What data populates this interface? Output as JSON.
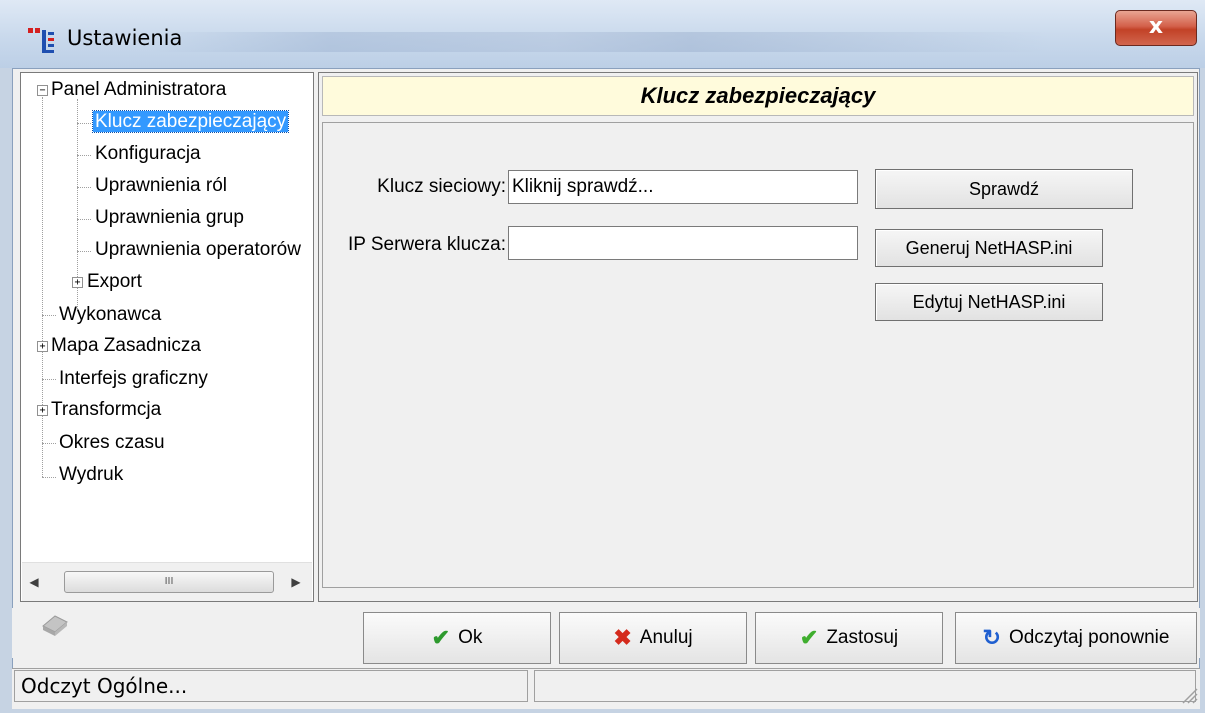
{
  "window": {
    "title": "Ustawienia",
    "close_label": "x"
  },
  "tree": {
    "items": [
      {
        "label": "Panel Administratora",
        "expander": "−"
      },
      {
        "label": "Klucz zabezpieczający",
        "selected": true
      },
      {
        "label": "Konfiguracja"
      },
      {
        "label": "Uprawnienia ról"
      },
      {
        "label": "Uprawnienia grup"
      },
      {
        "label": "Uprawnienia operatorów"
      },
      {
        "label": "Export",
        "expander": "+"
      },
      {
        "label": "Wykonawca"
      },
      {
        "label": "Mapa Zasadnicza",
        "expander": "+"
      },
      {
        "label": "Interfejs graficzny"
      },
      {
        "label": "Transformcja",
        "expander": "+"
      },
      {
        "label": "Okres czasu"
      },
      {
        "label": "Wydruk"
      }
    ],
    "scrollbar": {
      "left_arrow": "◀",
      "right_arrow": "▶",
      "thumb_grip": "III"
    }
  },
  "panel": {
    "header": "Klucz zabezpieczający",
    "network_key_label": "Klucz sieciowy:",
    "network_key_value": "Kliknij sprawdź...",
    "server_ip_label": "IP Serwera klucza:",
    "server_ip_value": "",
    "check_button": "Sprawdź",
    "generate_button": "Generuj NetHASP.ini",
    "edit_button": "Edytuj NetHASP.ini"
  },
  "actions": {
    "ok": "Ok",
    "cancel": "Anuluj",
    "apply": "Zastosuj",
    "reload": "Odczytaj ponownie"
  },
  "status": {
    "text": "Odczyt Ogólne...",
    "pane2": ""
  },
  "colors": {
    "selection": "#3399ff",
    "header_bg": "#fffbdc",
    "ok_check": "#2e9a2e",
    "cancel_x": "#d42a1c",
    "reload": "#1f5fd0"
  }
}
